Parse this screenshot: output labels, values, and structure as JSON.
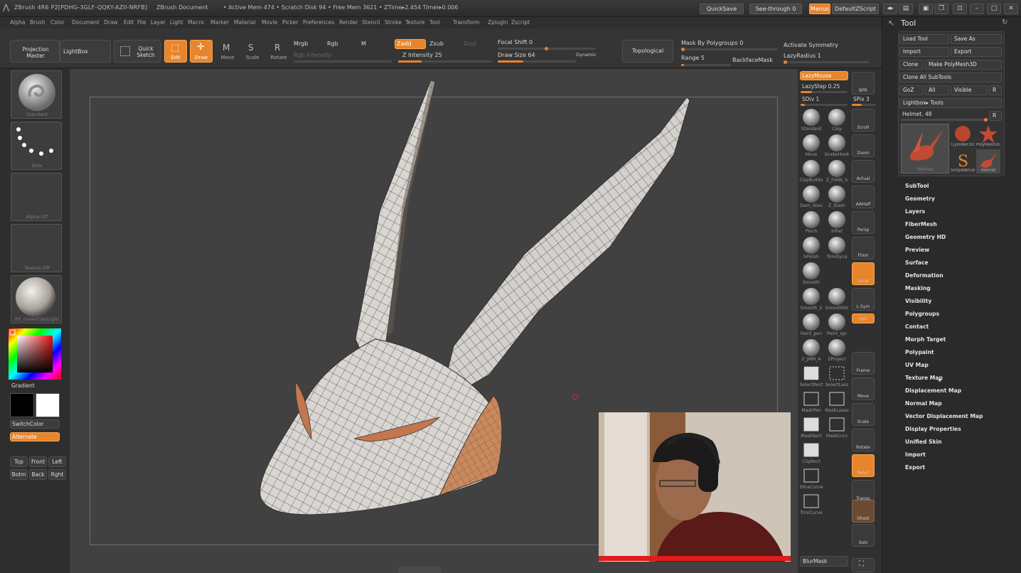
{
  "titlebar": {
    "app_title": "ZBrush 4R6 P2[PDHG-3GLF-QQKY-AZII-NRFB]",
    "document": "ZBrush Document",
    "stats": "• Active Mem 474  • Scratch Disk 94  • Free Mem 3621  • ZTime▸2.454  Timer▸0.006",
    "quicksave": "QuickSave",
    "see_through": "See-through  0",
    "menus": "Menus",
    "script": "DefaultZScript"
  },
  "menubar": [
    "Alpha",
    "Brush",
    "Color",
    "Document",
    "Draw",
    "Edit",
    "File",
    "Layer",
    "Light",
    "Macro",
    "Marker",
    "Material",
    "Movie",
    "Picker",
    "Preferences",
    "Render",
    "Stencil",
    "Stroke",
    "Texture",
    "Tool",
    "Transform",
    "Zplugin",
    "Zscript"
  ],
  "toolbar": {
    "projection_master": "Projection Master",
    "lightbox": "LightBox",
    "quick_sketch": "Quick Sketch",
    "edit": "Edit",
    "draw": "Draw",
    "move": "Move",
    "scale": "Scale",
    "rotate": "Rotate",
    "mrgb": "Mrgb",
    "rgb": "Rgb",
    "m": "M",
    "zadd": "Zadd",
    "zsub": "Zsub",
    "zcut": "Zcut",
    "rgb_intensity": "Rgb Intensity",
    "z_intensity": "Z Intensity 25",
    "focal_shift": "Focal Shift 0",
    "draw_size": "Draw Size 64",
    "dynamic": "Dynamic",
    "topological": "Topological",
    "mask_by_polygroups": "Mask By Polygroups 0",
    "range": "Range 5",
    "backface_mask": "BackfaceMask",
    "activate_symmetry": "Activate Symmetry",
    "lazy_radius": "LazyRadius 1",
    "z_intensity_level": 0.25,
    "draw_size_level": 0.33,
    "range_level": 0.05
  },
  "leftshelf": {
    "standard": "Standard",
    "dots": "Dots",
    "alpha_off": "Alpha  Off",
    "texture_off": "Texture  Off",
    "material": "RS_GreenClayLight",
    "gradient": "Gradient",
    "switchcolor": "SwitchColor",
    "alternate": "Alternate",
    "views": [
      "Top",
      "Front",
      "Left",
      "Botm",
      "Back",
      "Rght"
    ]
  },
  "brushshelf": {
    "lazymouse": "LazyMouse",
    "lazystep": "LazyStep 0.25",
    "sdiv": "SDiv 1",
    "spix": "SPix 3",
    "bpr": "BPR",
    "brushes": [
      "Standard",
      "Clay",
      "Move",
      "SnakeHook",
      "ClayBuildu",
      "Z_Folds_S",
      "Dam_Stan",
      "Z_Slash",
      "Pinch",
      "Inflat",
      "hPolish",
      "TrimDyna",
      "Smooth",
      "",
      "Smooth_S",
      "SmoothDir",
      "Paint_pen",
      "Paint_spr",
      "Z_JMM_A",
      "ZProject",
      "SelectRect",
      "SelectLass",
      "MaskPen",
      "MaskLasso",
      "MaskRect",
      "MaskCurv",
      "ClipRect",
      "",
      "SliceCurve",
      "",
      "TrimCurve",
      ""
    ],
    "right_buttons": [
      "Scroll",
      "Zoom",
      "Actual",
      "AAHalf",
      "Persp",
      "Floor",
      "Local",
      "L.Sym",
      "xyz",
      "",
      "",
      "Frame",
      "Move",
      "Scale",
      "Rotate",
      "PolyF",
      "Transp",
      "Ghost",
      "Solo"
    ],
    "blurmask": "BlurMask"
  },
  "tray": {
    "title": "Tool",
    "load_tool": "Load Tool",
    "save_as": "Save As",
    "import": "Import",
    "export": "Export",
    "clone": "Clone",
    "make_polymesh": "Make PolyMesh3D",
    "clone_all": "Clone  All SubTools",
    "goz": "GoZ",
    "all": "All",
    "visible": "Visible",
    "r": "R",
    "lightbox_tools": "Lightbox▸ Tools",
    "helmet": "Helmet. 48",
    "tool_thumbs": [
      "Cylinder3D",
      "PolyMesh3D",
      "SimpleBrush",
      "Helmet"
    ],
    "main_thumb": "Helmet",
    "menu": [
      "SubTool",
      "Geometry",
      "Layers",
      "FiberMesh",
      "Geometry HD",
      "Preview",
      "Surface",
      "Deformation",
      "Masking",
      "Visibility",
      "Polygroups",
      "Contact",
      "Morph Target",
      "Polypaint",
      "UV Map",
      "Texture Map",
      "Displacement Map",
      "Normal Map",
      "Vector Displacement Map",
      "Display Properties",
      "Unified Skin",
      "Import",
      "Export"
    ]
  },
  "colors": {
    "accent": "#e8822f",
    "mesh": "#d6d2ce",
    "wire": "#3d3a38",
    "canvas": "#414141"
  }
}
